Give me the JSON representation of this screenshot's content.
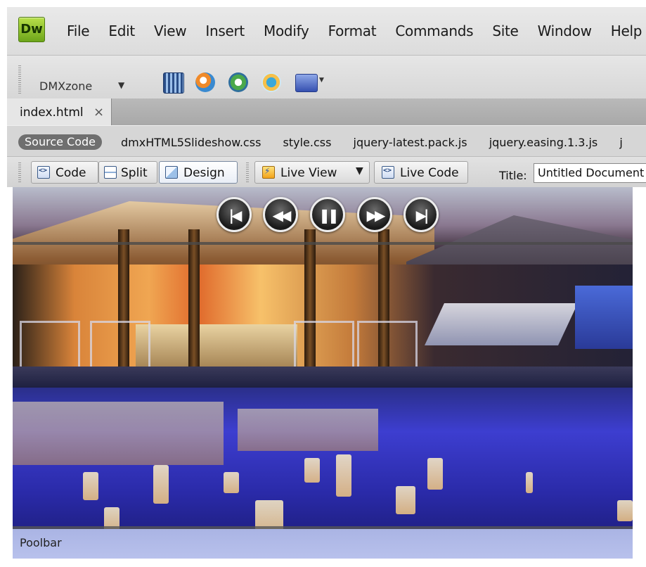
{
  "app": {
    "logo_text": "Dw",
    "menu": [
      "File",
      "Edit",
      "View",
      "Insert",
      "Modify",
      "Format",
      "Commands",
      "Site",
      "Window",
      "Help"
    ]
  },
  "insert_toolbar": {
    "category_label": "DMXzone",
    "icons": [
      "html5-slideshow-icon",
      "image-gallery-icon",
      "video-player-icon",
      "audio-player-icon",
      "lightbox-icon"
    ]
  },
  "document_tab": {
    "filename": "index.html",
    "close_glyph": "×"
  },
  "related_files": {
    "source_label": "Source Code",
    "files": [
      "dmxHTML5Slideshow.css",
      "style.css",
      "jquery-latest.pack.js",
      "jquery.easing.1.3.js",
      "j"
    ]
  },
  "document_toolbar": {
    "code_label": "Code",
    "split_label": "Split",
    "design_label": "Design",
    "live_view_label": "Live View",
    "live_code_label": "Live Code",
    "title_label": "Title:",
    "title_value": "Untitled Document"
  },
  "slideshow": {
    "controls": [
      {
        "name": "first-slide",
        "glyph": "|◀"
      },
      {
        "name": "previous-slide",
        "glyph": "◀◀"
      },
      {
        "name": "pause",
        "glyph": "❚❚"
      },
      {
        "name": "next-slide",
        "glyph": "▶▶"
      },
      {
        "name": "last-slide",
        "glyph": "▶|"
      }
    ],
    "caption": "Poolbar"
  },
  "colors": {
    "dw_logo": "#8cc63f",
    "caption_band": "#b2bbe9",
    "related_pill": "#6f6f6f"
  }
}
